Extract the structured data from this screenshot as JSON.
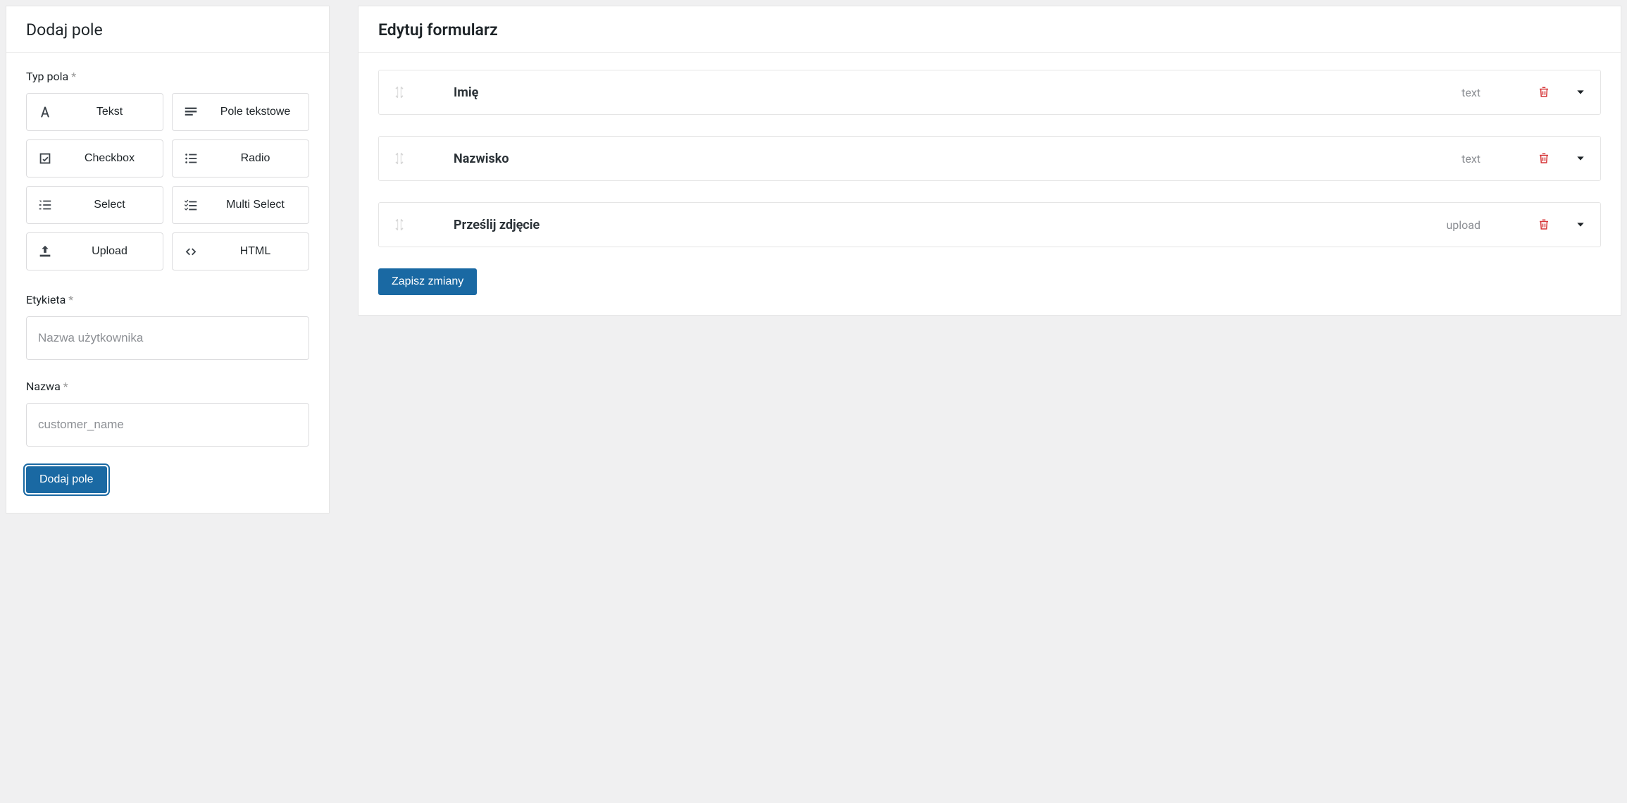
{
  "left": {
    "title": "Dodaj pole",
    "type_label": "Typ pola",
    "types": {
      "text": "Tekst",
      "textarea": "Pole tekstowe",
      "checkbox": "Checkbox",
      "radio": "Radio",
      "select": "Select",
      "multiselect": "Multi Select",
      "upload": "Upload",
      "html": "HTML"
    },
    "label_label": "Etykieta",
    "label_placeholder": "Nazwa użytkownika",
    "name_label": "Nazwa",
    "name_placeholder": "customer_name",
    "add_button": "Dodaj pole",
    "asterisk": "*"
  },
  "right": {
    "title": "Edytuj formularz",
    "fields": [
      {
        "label": "Imię",
        "type": "text"
      },
      {
        "label": "Nazwisko",
        "type": "text"
      },
      {
        "label": "Prześlij zdjęcie",
        "type": "upload"
      }
    ],
    "save_button": "Zapisz zmiany"
  }
}
